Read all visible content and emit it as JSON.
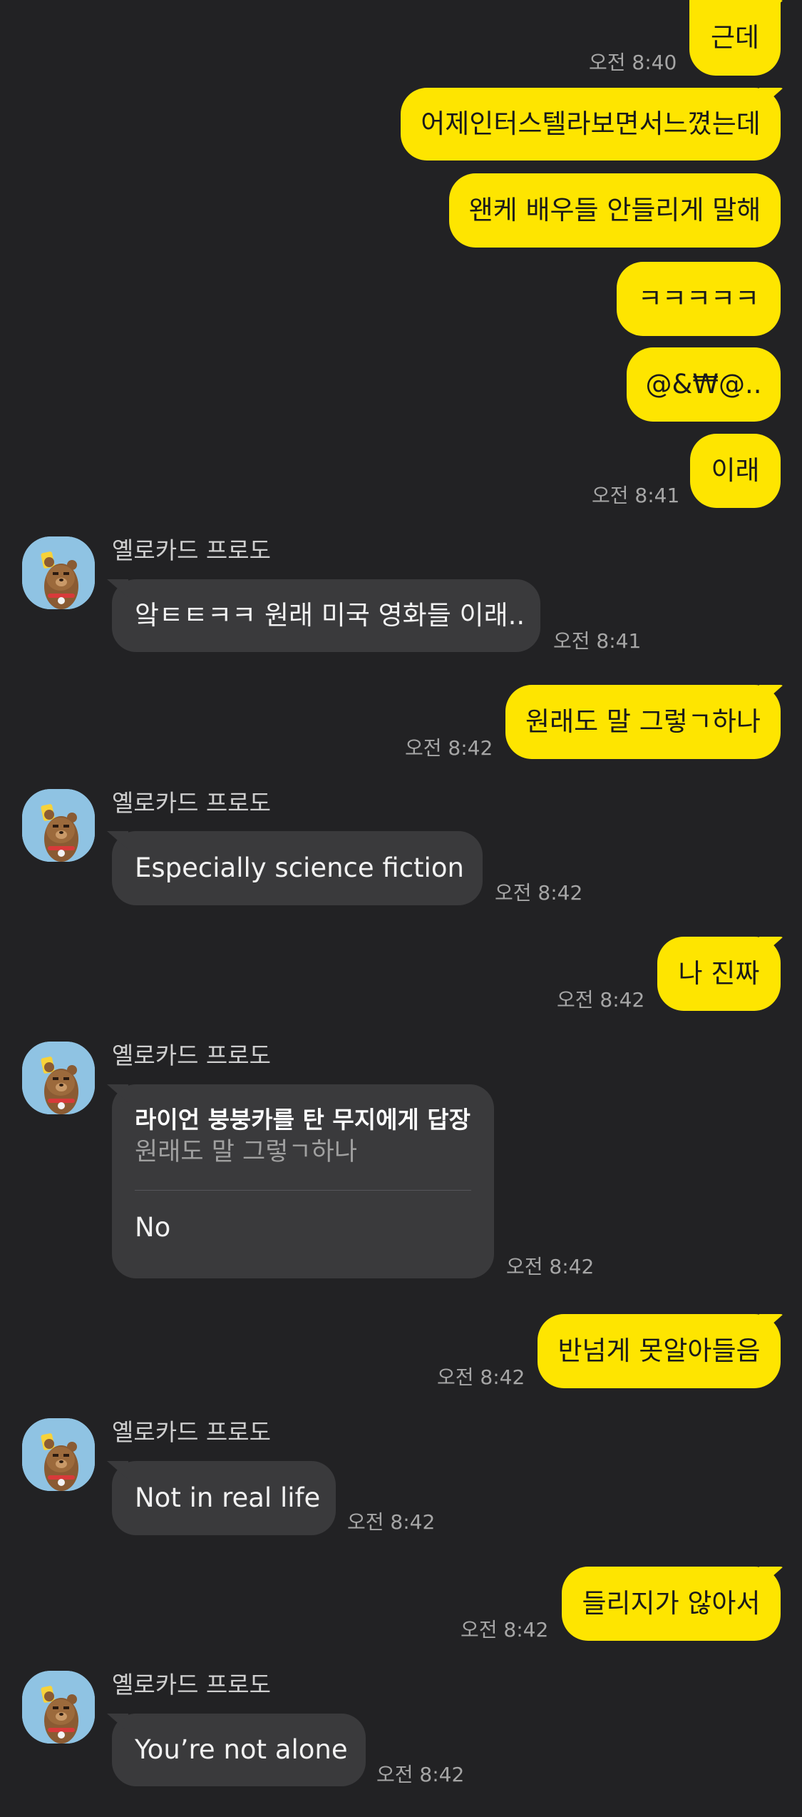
{
  "sender_name": "옐로카드 프로도",
  "messages": [
    {
      "text": "근데"
    },
    {
      "text": "어제인터스텔라보면서느꼈는데"
    },
    {
      "text": "왠케 배우들 안들리게 말해"
    },
    {
      "text": "ㅋㅋㅋㅋㅋ"
    },
    {
      "text": "@&₩@.."
    },
    {
      "text": "이래"
    },
    {
      "text": "앜ㅌㅌㅋㅋ 원래 미국 영화들 이래.."
    },
    {
      "text": "원래도 말 그렇ㄱ하나"
    },
    {
      "text": "Especially science fiction"
    },
    {
      "text": "나 진짜"
    },
    {
      "reply_title": "라이언 붕붕카를 탄 무지에게 답장",
      "reply_quote": "원래도 말 그렇ㄱ하나",
      "text": "No"
    },
    {
      "text": "반넘게 못알아들음"
    },
    {
      "text": "Not in real life"
    },
    {
      "text": "들리지가 않아서"
    },
    {
      "text": "You’re not alone"
    }
  ],
  "times": {
    "t1": "오전 8:40",
    "t2": "오전 8:41",
    "t3": "오전 8:41",
    "t4": "오전 8:42",
    "t5": "오전 8:42",
    "t6": "오전 8:42",
    "t7": "오전 8:42",
    "t8": "오전 8:42",
    "t9": "오전 8:42",
    "t10": "오전 8:42",
    "t11": "오전 8:42"
  },
  "colors": {
    "background": "#222224",
    "outgoing_bubble": "#FEE500",
    "incoming_bubble": "#3a3a3c",
    "avatar_bg": "#8fc3e3"
  }
}
